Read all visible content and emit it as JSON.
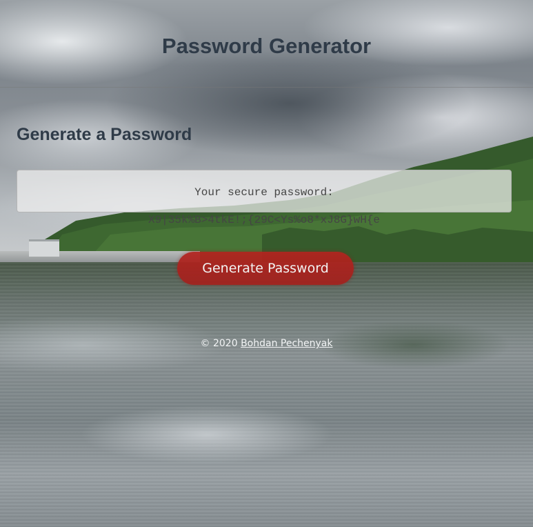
{
  "header": {
    "title": "Password Generator"
  },
  "card": {
    "heading": "Generate a Password",
    "password_label": "Your secure password:",
    "password_value": "X9|35k%B>4tkE!;{29C<Ys%o8*xJ8G}wH{e"
  },
  "actions": {
    "generate_label": "Generate Password",
    "button_color": "#b3241f"
  },
  "footer": {
    "copyright": "© 2020",
    "author_link": "Bohdan Pechenyak"
  },
  "colors": {
    "heading_text": "#2f3b48",
    "accent": "#b3241f"
  }
}
